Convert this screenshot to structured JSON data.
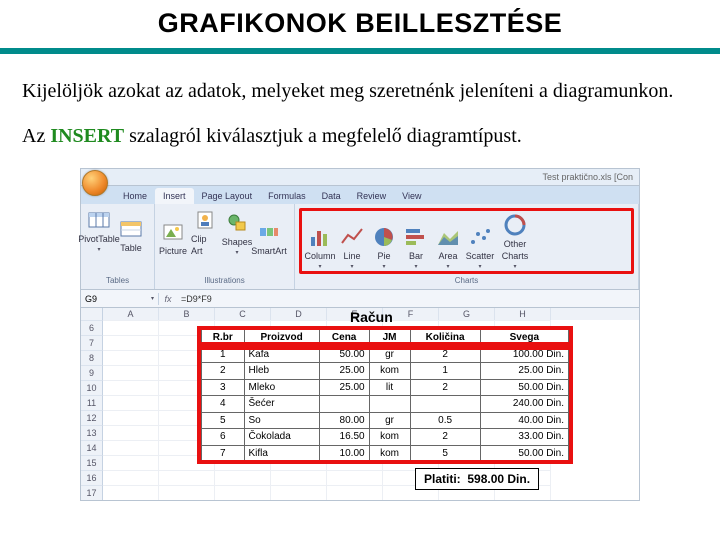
{
  "title": "GRAFIKONOK BEILLESZTÉSE",
  "paragraph1": "Kijelöljök azokat az adatok, melyeket meg szeretnénk jeleníteni a diagramunkon.",
  "paragraph2_pre": "Az ",
  "paragraph2_insert": "INSERT",
  "paragraph2_post": " szalagról kiválasztjuk a megfelelő diagramtípust.",
  "excel": {
    "window_title_right": "Test praktično.xls  [Con",
    "tabs": [
      "Home",
      "Insert",
      "Page Layout",
      "Formulas",
      "Data",
      "Review",
      "View"
    ],
    "active_tab": "Insert",
    "groups": {
      "tables": {
        "label": "Tables",
        "items": [
          "PivotTable",
          "Table"
        ]
      },
      "illustrations": {
        "label": "Illustrations",
        "items": [
          "Picture",
          "Clip Art",
          "Shapes",
          "SmartArt"
        ]
      },
      "charts": {
        "label": "Charts",
        "items": [
          "Column",
          "Line",
          "Pie",
          "Bar",
          "Area",
          "Scatter",
          "Other Charts"
        ]
      }
    },
    "namebox": "G9",
    "formula": "=D9*F9",
    "col_headers": [
      "A",
      "B",
      "C",
      "D",
      "E",
      "F",
      "G",
      "H"
    ],
    "row_headers": [
      "6",
      "7",
      "8",
      "9",
      "10",
      "11",
      "12",
      "13",
      "14",
      "15",
      "16",
      "17"
    ]
  },
  "racun": {
    "title": "Račun",
    "headers": [
      "R.br",
      "Proizvod",
      "Cena",
      "JM",
      "Količina",
      "Svega"
    ],
    "rows": [
      [
        "1",
        "Kafa",
        "50.00",
        "gr",
        "2",
        "100.00 Din."
      ],
      [
        "2",
        "Hleb",
        "25.00",
        "kom",
        "1",
        "25.00 Din."
      ],
      [
        "3",
        "Mleko",
        "25.00",
        "lit",
        "2",
        "50.00 Din."
      ],
      [
        "4",
        "Šećer",
        "",
        "",
        "",
        "240.00 Din."
      ],
      [
        "5",
        "So",
        "80.00",
        "gr",
        "0.5",
        "40.00 Din."
      ],
      [
        "6",
        "Čokolada",
        "16.50",
        "kom",
        "2",
        "33.00 Din."
      ],
      [
        "7",
        "Kifla",
        "10.00",
        "kom",
        "5",
        "50.00 Din."
      ]
    ],
    "footer_label": "Platiti:",
    "footer_value": "598.00 Din."
  }
}
